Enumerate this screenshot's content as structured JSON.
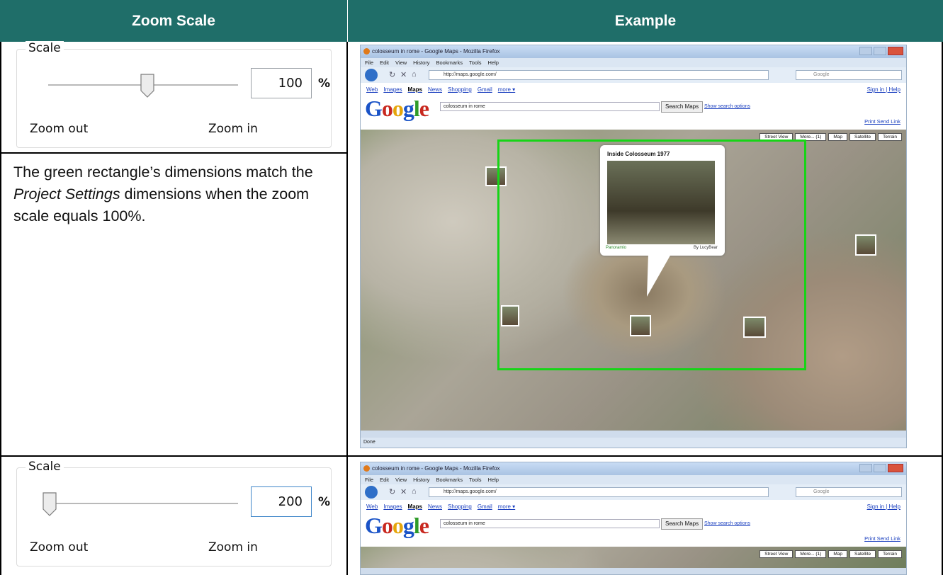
{
  "table": {
    "col1_header": "Zoom Scale",
    "col2_header": "Example",
    "header_color": "#1f6e69",
    "rows": [
      {
        "scale": {
          "legend": "Scale",
          "value": "100",
          "unit": "%",
          "zoom_out": "Zoom out",
          "zoom_in": "Zoom in",
          "slider_level": 0.5
        },
        "description": {
          "part1": "The green rectangle’s dimensions match the ",
          "emph": "Project Settings",
          "part2": " dimensions when the zoom scale equals 100%."
        }
      },
      {
        "scale": {
          "legend": "Scale",
          "value": "200",
          "unit": "%",
          "zoom_out": "Zoom out",
          "zoom_in": "Zoom in",
          "slider_level": 0.0
        }
      }
    ]
  },
  "browser": {
    "title": "colosseum in rome - Google Maps - Mozilla Firefox",
    "menu": [
      "File",
      "Edit",
      "View",
      "History",
      "Bookmarks",
      "Tools",
      "Help"
    ],
    "url": "http://maps.google.com/",
    "search_placeholder": "Google",
    "google_links": [
      "Web",
      "Images",
      "Maps",
      "News",
      "Shopping",
      "Gmail",
      "more ▾"
    ],
    "active_link": "Maps",
    "signin": "Sign in | Help",
    "logo": [
      "G",
      "o",
      "o",
      "g",
      "l",
      "e"
    ],
    "query": "colosseum in rome",
    "search_button": "Search Maps",
    "show_options": "Show search options",
    "map_links": "Print  Send  Link",
    "map_tabs": [
      "Street View",
      "More... (1)",
      "Map",
      "Satellite",
      "Terrain"
    ],
    "popup_title": "Inside Colosseum 1977",
    "popup_source": "Panoramio",
    "popup_by": "By LucyBear",
    "status": "Done"
  }
}
